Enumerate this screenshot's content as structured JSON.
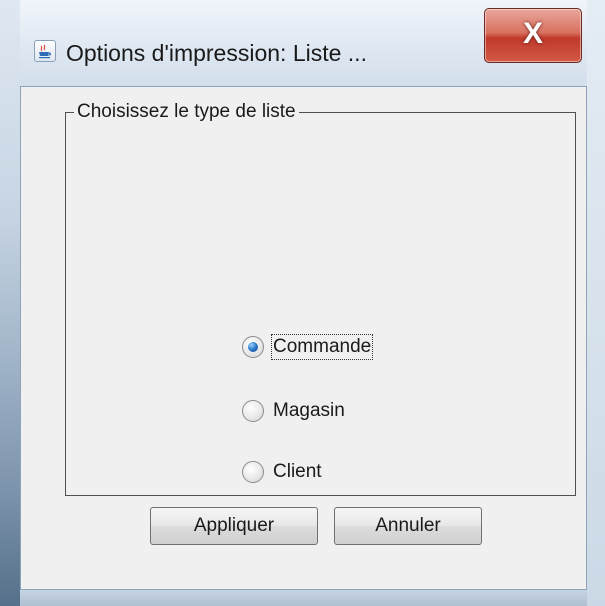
{
  "window": {
    "title": "Options d'impression: Liste ...",
    "close_label": "X",
    "app_icon": "java-coffee-cup-icon"
  },
  "group": {
    "legend": "Choisissez le type de liste"
  },
  "radio_options": [
    {
      "label": "Commande",
      "checked": true,
      "focused": true
    },
    {
      "label": "Magasin",
      "checked": false,
      "focused": false
    },
    {
      "label": "Client",
      "checked": false,
      "focused": false
    }
  ],
  "buttons": {
    "apply_label": "Appliquer",
    "cancel_label": "Annuler"
  },
  "colors": {
    "close_button": "#c0392b",
    "radio_selected": "#2f7fd0",
    "background": "#f0f0f0"
  }
}
